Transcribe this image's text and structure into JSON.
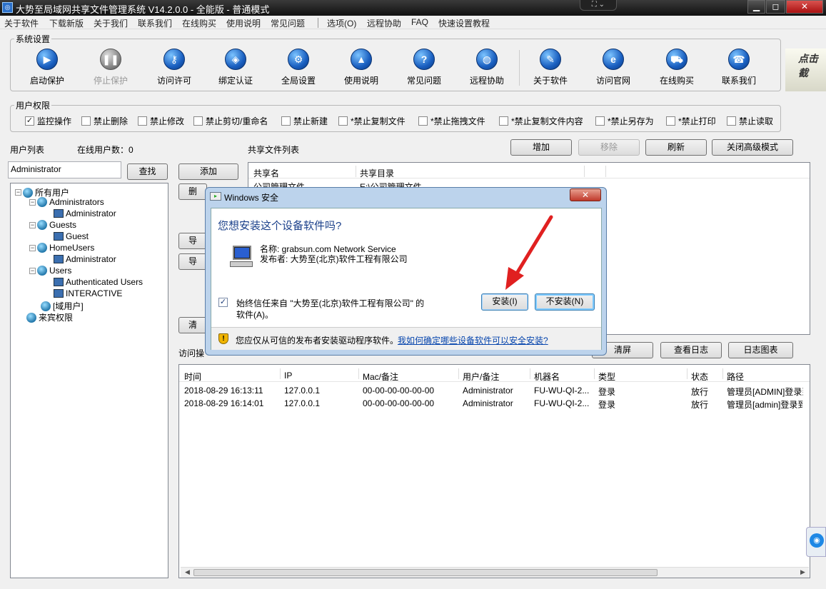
{
  "window": {
    "title": "大势至局域网共享文件管理系统 V14.2.0.0 - 全能版 - 普通模式",
    "min": "▁",
    "restore": "◻",
    "close": "✕"
  },
  "menu": [
    "关于软件",
    "下载新版",
    "关于我们",
    "联系我们",
    "在线购买",
    "使用说明",
    "常见问题",
    "选项(O)",
    "远程协助",
    "FAQ",
    "快速设置教程"
  ],
  "system_settings": {
    "label": "系统设置",
    "tools": [
      {
        "label": "启动保护",
        "icon": "play-icon",
        "glyph": "▶"
      },
      {
        "label": "停止保护",
        "icon": "pause-icon",
        "glyph": "❚❚"
      },
      {
        "label": "访问许可",
        "icon": "key-icon",
        "glyph": "⚷"
      },
      {
        "label": "绑定认证",
        "icon": "shield-icon",
        "glyph": "◈"
      },
      {
        "label": "全局设置",
        "icon": "gear-icon",
        "glyph": "⚙"
      },
      {
        "label": "使用说明",
        "icon": "graduation-cap-icon",
        "glyph": "▲"
      },
      {
        "label": "常见问题",
        "icon": "question-icon",
        "glyph": "?"
      },
      {
        "label": "远程协助",
        "icon": "globe-icon",
        "glyph": "◍"
      },
      {
        "label": "关于软件",
        "icon": "document-icon",
        "glyph": "✎"
      },
      {
        "label": "访问官网",
        "icon": "ie-icon",
        "glyph": "e"
      },
      {
        "label": "在线购买",
        "icon": "cart-icon",
        "glyph": "⛟"
      },
      {
        "label": "联系我们",
        "icon": "phone-icon",
        "glyph": "☎"
      }
    ],
    "side_text": "点击 截"
  },
  "user_permissions": {
    "label": "用户权限",
    "items": [
      {
        "label": "监控操作",
        "checked": true
      },
      {
        "label": "禁止删除",
        "checked": false
      },
      {
        "label": "禁止修改",
        "checked": false
      },
      {
        "label": "禁止剪切/重命名",
        "checked": false
      },
      {
        "label": "禁止新建",
        "checked": false
      },
      {
        "label": "*禁止复制文件",
        "checked": false
      },
      {
        "label": "*禁止拖拽文件",
        "checked": false
      },
      {
        "label": "*禁止复制文件内容",
        "checked": false
      },
      {
        "label": "*禁止另存为",
        "checked": false
      },
      {
        "label": "*禁止打印",
        "checked": false
      },
      {
        "label": "禁止读取",
        "checked": false
      }
    ]
  },
  "user_list": {
    "label": "用户列表",
    "online_label": "在线用户数：0",
    "search_value": "Administrator",
    "find_btn": "查找",
    "tree": [
      "所有用户",
      "Administrators",
      "Administrator",
      "Guests",
      "Guest",
      "HomeUsers",
      "Administrator",
      "Users",
      "Authenticated Users",
      "INTERACTIVE",
      "[域用户]",
      "来宾权限"
    ]
  },
  "middle_buttons": {
    "add": "添加",
    "b2": "删",
    "b3": "导",
    "b4": "导",
    "b5": "清"
  },
  "shared": {
    "label": "共享文件列表",
    "add": "增加",
    "remove": "移除",
    "refresh": "刷新",
    "close_adv": "关闭高级模式",
    "col_name": "共享名",
    "col_dir": "共享目录",
    "row_name": "公司管理文件",
    "row_dir": "E:\\公司管理文件"
  },
  "log": {
    "label": "访问操",
    "clear": "清屏",
    "view": "查看日志",
    "chart": "日志图表",
    "headers": [
      "时间",
      "IP",
      "Mac/备注",
      "用户/备注",
      "机器名",
      "类型",
      "状态",
      "路径"
    ],
    "rows": [
      [
        "2018-08-29 16:13:11",
        "127.0.0.1",
        "00-00-00-00-00-00",
        "Administrator",
        "FU-WU-QI-2...",
        "登录",
        "放行",
        "管理员[ADMIN]登录到"
      ],
      [
        "2018-08-29 16:14:01",
        "127.0.0.1",
        "00-00-00-00-00-00",
        "Administrator",
        "FU-WU-QI-2...",
        "登录",
        "放行",
        "管理员[admin]登录到"
      ]
    ]
  },
  "dialog": {
    "title": "Windows 安全",
    "close": "✕",
    "question": "您想安装这个设备软件吗?",
    "name_line": "名称: grabsun.com Network Service",
    "publisher_line": "发布者: 大势至(北京)软件工程有限公司",
    "trust_line1": "始终信任来自 \"大势至(北京)软件工程有限公司\" 的",
    "trust_line2": "软件(A)。",
    "trust_checked": true,
    "install": "安装(I)",
    "dont_install": "不安装(N)",
    "warning": "您应仅从可信的发布者安装驱动程序软件。",
    "link": "我如何确定哪些设备软件可以安全安装?"
  },
  "colors": {
    "accent": "#1a5fc0",
    "arrow": "#e02020",
    "link": "#0645ad"
  }
}
